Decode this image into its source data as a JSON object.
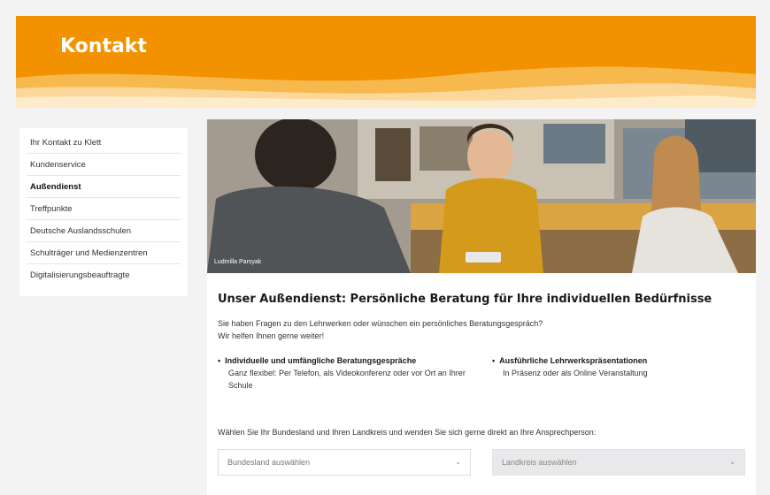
{
  "header": {
    "title": "Kontakt"
  },
  "colors": {
    "accent": "#f39200",
    "accent_light": "#f7b94e"
  },
  "sidebar": {
    "items": [
      {
        "label": "Ihr Kontakt zu Klett",
        "active": false
      },
      {
        "label": "Kundenservice",
        "active": false
      },
      {
        "label": "Außendienst",
        "active": true
      },
      {
        "label": "Treffpunkte",
        "active": false
      },
      {
        "label": "Deutsche Auslandsschulen",
        "active": false
      },
      {
        "label": "Schulträger und Medienzentren",
        "active": false
      },
      {
        "label": "Digitalisierungsbeauftragte",
        "active": false
      }
    ]
  },
  "hero": {
    "caption": "Ludmilla Parsyak"
  },
  "main": {
    "heading": "Unser Außendienst: Persönliche Beratung für Ihre individuellen Bedürfnisse",
    "intro_line1": "Sie haben Fragen zu den Lehrwerken oder wünschen ein persönliches Beratungsgespräch?",
    "intro_line2": "Wir helfen Ihnen gerne weiter!",
    "features": [
      {
        "title": "Individuelle und umfängliche Beratungsgespräche",
        "text": "Ganz flexibel: Per Telefon, als Videokonferenz oder vor Ort an Ihrer Schule"
      },
      {
        "title": "Ausführliche Lehrwerkspräsentationen",
        "text": "In Präsenz oder als Online Veranstaltung"
      }
    ],
    "select_hint": "Wählen Sie Ihr Bundesland und Ihren Landkreis und wenden Sie sich gerne direkt an Ihre Ansprechperson:",
    "bundesland": {
      "placeholder": "Bundesland auswählen"
    },
    "landkreis": {
      "placeholder": "Landkreis auswählen"
    }
  },
  "icons": {
    "dropdown": "chevron-down-icon"
  }
}
